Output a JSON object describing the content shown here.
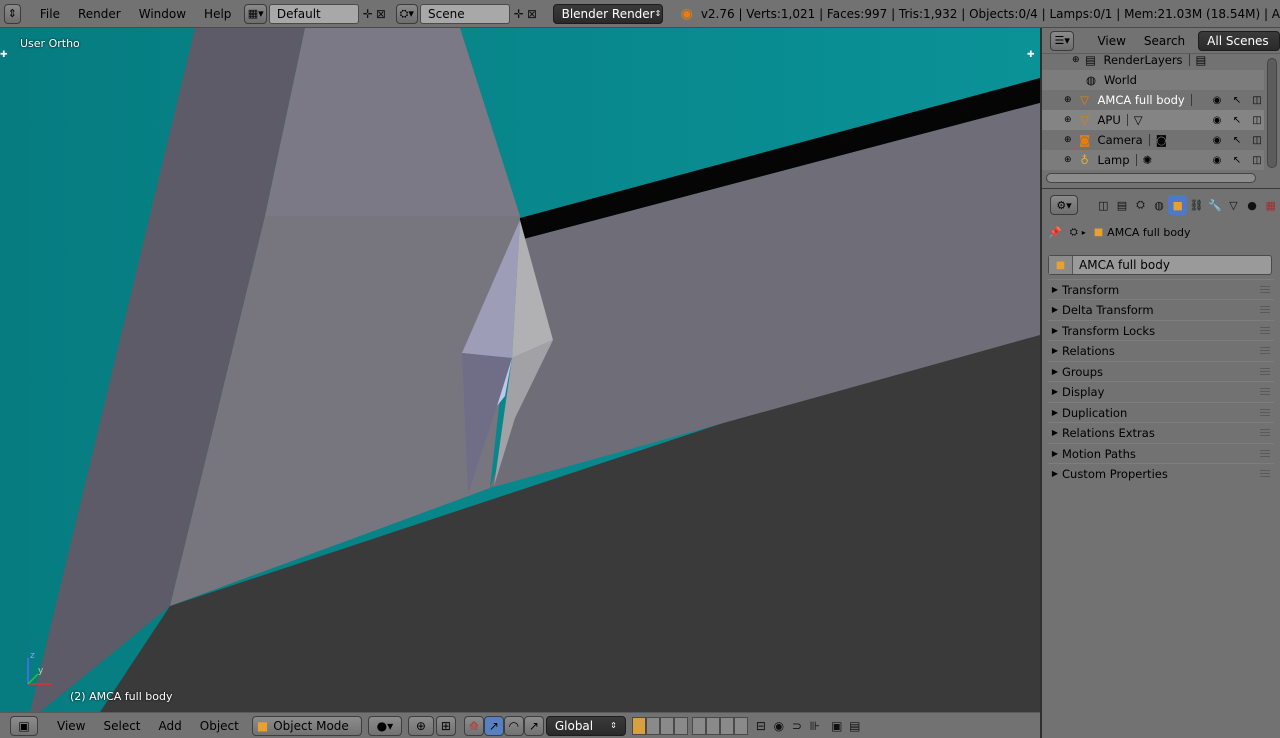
{
  "topbar": {
    "menus": [
      "File",
      "Render",
      "Window",
      "Help"
    ],
    "screen_layout": "Default",
    "scene": "Scene",
    "render_engine": "Blender Render",
    "stats": "v2.76 | Verts:1,021 | Faces:997 | Tris:1,932 | Objects:0/4 | Lamps:0/1 | Mem:21.03M (18.54M) | A"
  },
  "viewport": {
    "view_label": "User Ortho",
    "object_label": "(2) AMCA full body",
    "axis_z": "z",
    "axis_y": "y",
    "background_color": "#00888c"
  },
  "bottombar": {
    "menus": [
      "View",
      "Select",
      "Add",
      "Object"
    ],
    "mode": "Object Mode",
    "transform_orientation": "Global"
  },
  "outliner": {
    "header_menus": [
      "View",
      "Search"
    ],
    "scene_filter": "All Scenes",
    "items": [
      {
        "label": "RenderLayers",
        "icon": "render-layers-icon"
      },
      {
        "label": "World",
        "icon": "world-icon"
      },
      {
        "label": "AMCA full body",
        "icon": "mesh-icon"
      },
      {
        "label": "APU",
        "icon": "mesh-icon"
      },
      {
        "label": "Camera",
        "icon": "camera-icon"
      },
      {
        "label": "Lamp",
        "icon": "lamp-icon"
      }
    ]
  },
  "properties": {
    "context_path": "AMCA full body",
    "object_name": "AMCA full body",
    "panels": [
      "Transform",
      "Delta Transform",
      "Transform Locks",
      "Relations",
      "Groups",
      "Display",
      "Duplication",
      "Relations Extras",
      "Motion Paths",
      "Custom Properties"
    ]
  }
}
